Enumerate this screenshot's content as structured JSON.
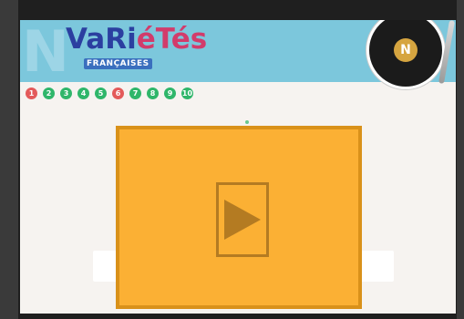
{
  "banner": {
    "letter": "N",
    "logo_part1": "VaRi",
    "logo_part2": "éTés",
    "logo_sub": "FRANÇAISES",
    "record_label": "N"
  },
  "levels": [
    "1",
    "2",
    "3",
    "4",
    "5",
    "6",
    "7",
    "8",
    "9",
    "10"
  ],
  "colors": {
    "banner": "#7cc7dc",
    "level_red": "#e35a5a",
    "level_green": "#2fb66a",
    "overlay": "#fbb034",
    "play_icon": "#b47b22"
  },
  "icons": {
    "play": "play-icon",
    "record": "vinyl-record-icon"
  }
}
